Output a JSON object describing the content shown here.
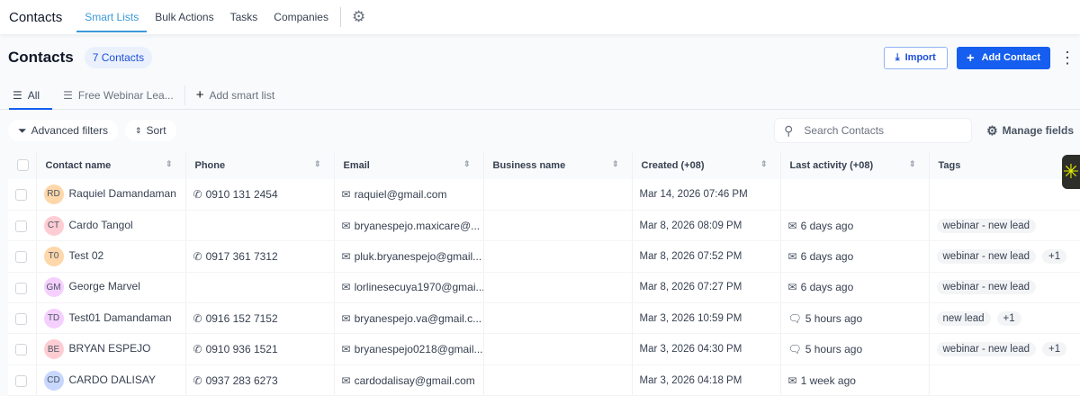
{
  "nav": {
    "brand": "Contacts",
    "tabs": [
      "Smart Lists",
      "Bulk Actions",
      "Tasks",
      "Companies"
    ]
  },
  "header": {
    "title": "Contacts",
    "count": "7 Contacts",
    "import": "Import",
    "add": "Add Contact"
  },
  "lists": {
    "all": "All",
    "webinar": "Free Webinar Lea...",
    "add": "Add smart list"
  },
  "toolbar": {
    "filters": "Advanced filters",
    "sort": "Sort",
    "search_placeholder": "Search Contacts",
    "manage": "Manage fields"
  },
  "columns": [
    "Contact name",
    "Phone",
    "Email",
    "Business name",
    "Created (+08)",
    "Last activity (+08)",
    "Tags"
  ],
  "rows": [
    {
      "initials": "RD",
      "color": "#fed7aa",
      "name": "Raquiel Damandaman",
      "phone": "0910 131 2454",
      "email": "raquiel@gmail.com",
      "created": "Mar 14, 2026 07:46 PM",
      "activity": "",
      "activity_icon": "",
      "tag": "",
      "extra": ""
    },
    {
      "initials": "CT",
      "color": "#fecdd3",
      "name": "Cardo Tangol",
      "phone": "",
      "email": "bryanespejo.maxicare@...",
      "created": "Mar 8, 2026 08:09 PM",
      "activity": "6 days ago",
      "activity_icon": "mail",
      "tag": "webinar - new lead",
      "extra": ""
    },
    {
      "initials": "T0",
      "color": "#fed7aa",
      "name": "Test 02",
      "phone": "0917 361 7312",
      "email": "pluk.bryanespejo@gmail...",
      "created": "Mar 8, 2026 07:52 PM",
      "activity": "6 days ago",
      "activity_icon": "mail",
      "tag": "webinar - new lead",
      "extra": "+1"
    },
    {
      "initials": "GM",
      "color": "#f5d0fe",
      "name": "George Marvel",
      "phone": "",
      "email": "lorlinesecuya1970@gmai...",
      "created": "Mar 8, 2026 07:27 PM",
      "activity": "6 days ago",
      "activity_icon": "mail",
      "tag": "webinar - new lead",
      "extra": ""
    },
    {
      "initials": "TD",
      "color": "#f5d0fe",
      "name": "Test01 Damandaman",
      "phone": "0916 152 7152",
      "email": "bryanespejo.va@gmail.c...",
      "created": "Mar 3, 2026 10:59 PM",
      "activity": "5 hours ago",
      "activity_icon": "chat",
      "tag": "new lead",
      "extra": "+1"
    },
    {
      "initials": "BE",
      "color": "#fecdd3",
      "name": "BRYAN ESPEJO",
      "phone": "0910 936 1521",
      "email": "bryanespejo0218@gmail...",
      "created": "Mar 3, 2026 04:30 PM",
      "activity": "5 hours ago",
      "activity_icon": "chat",
      "tag": "webinar - new lead",
      "extra": "+1"
    },
    {
      "initials": "CD",
      "color": "#c7d7fe",
      "name": "CARDO DALISAY",
      "phone": "0937 283 6273",
      "email": "cardodalisay@gmail.com",
      "created": "Mar 3, 2026 04:18 PM",
      "activity": "1 week ago",
      "activity_icon": "mail",
      "tag": "",
      "extra": ""
    }
  ]
}
